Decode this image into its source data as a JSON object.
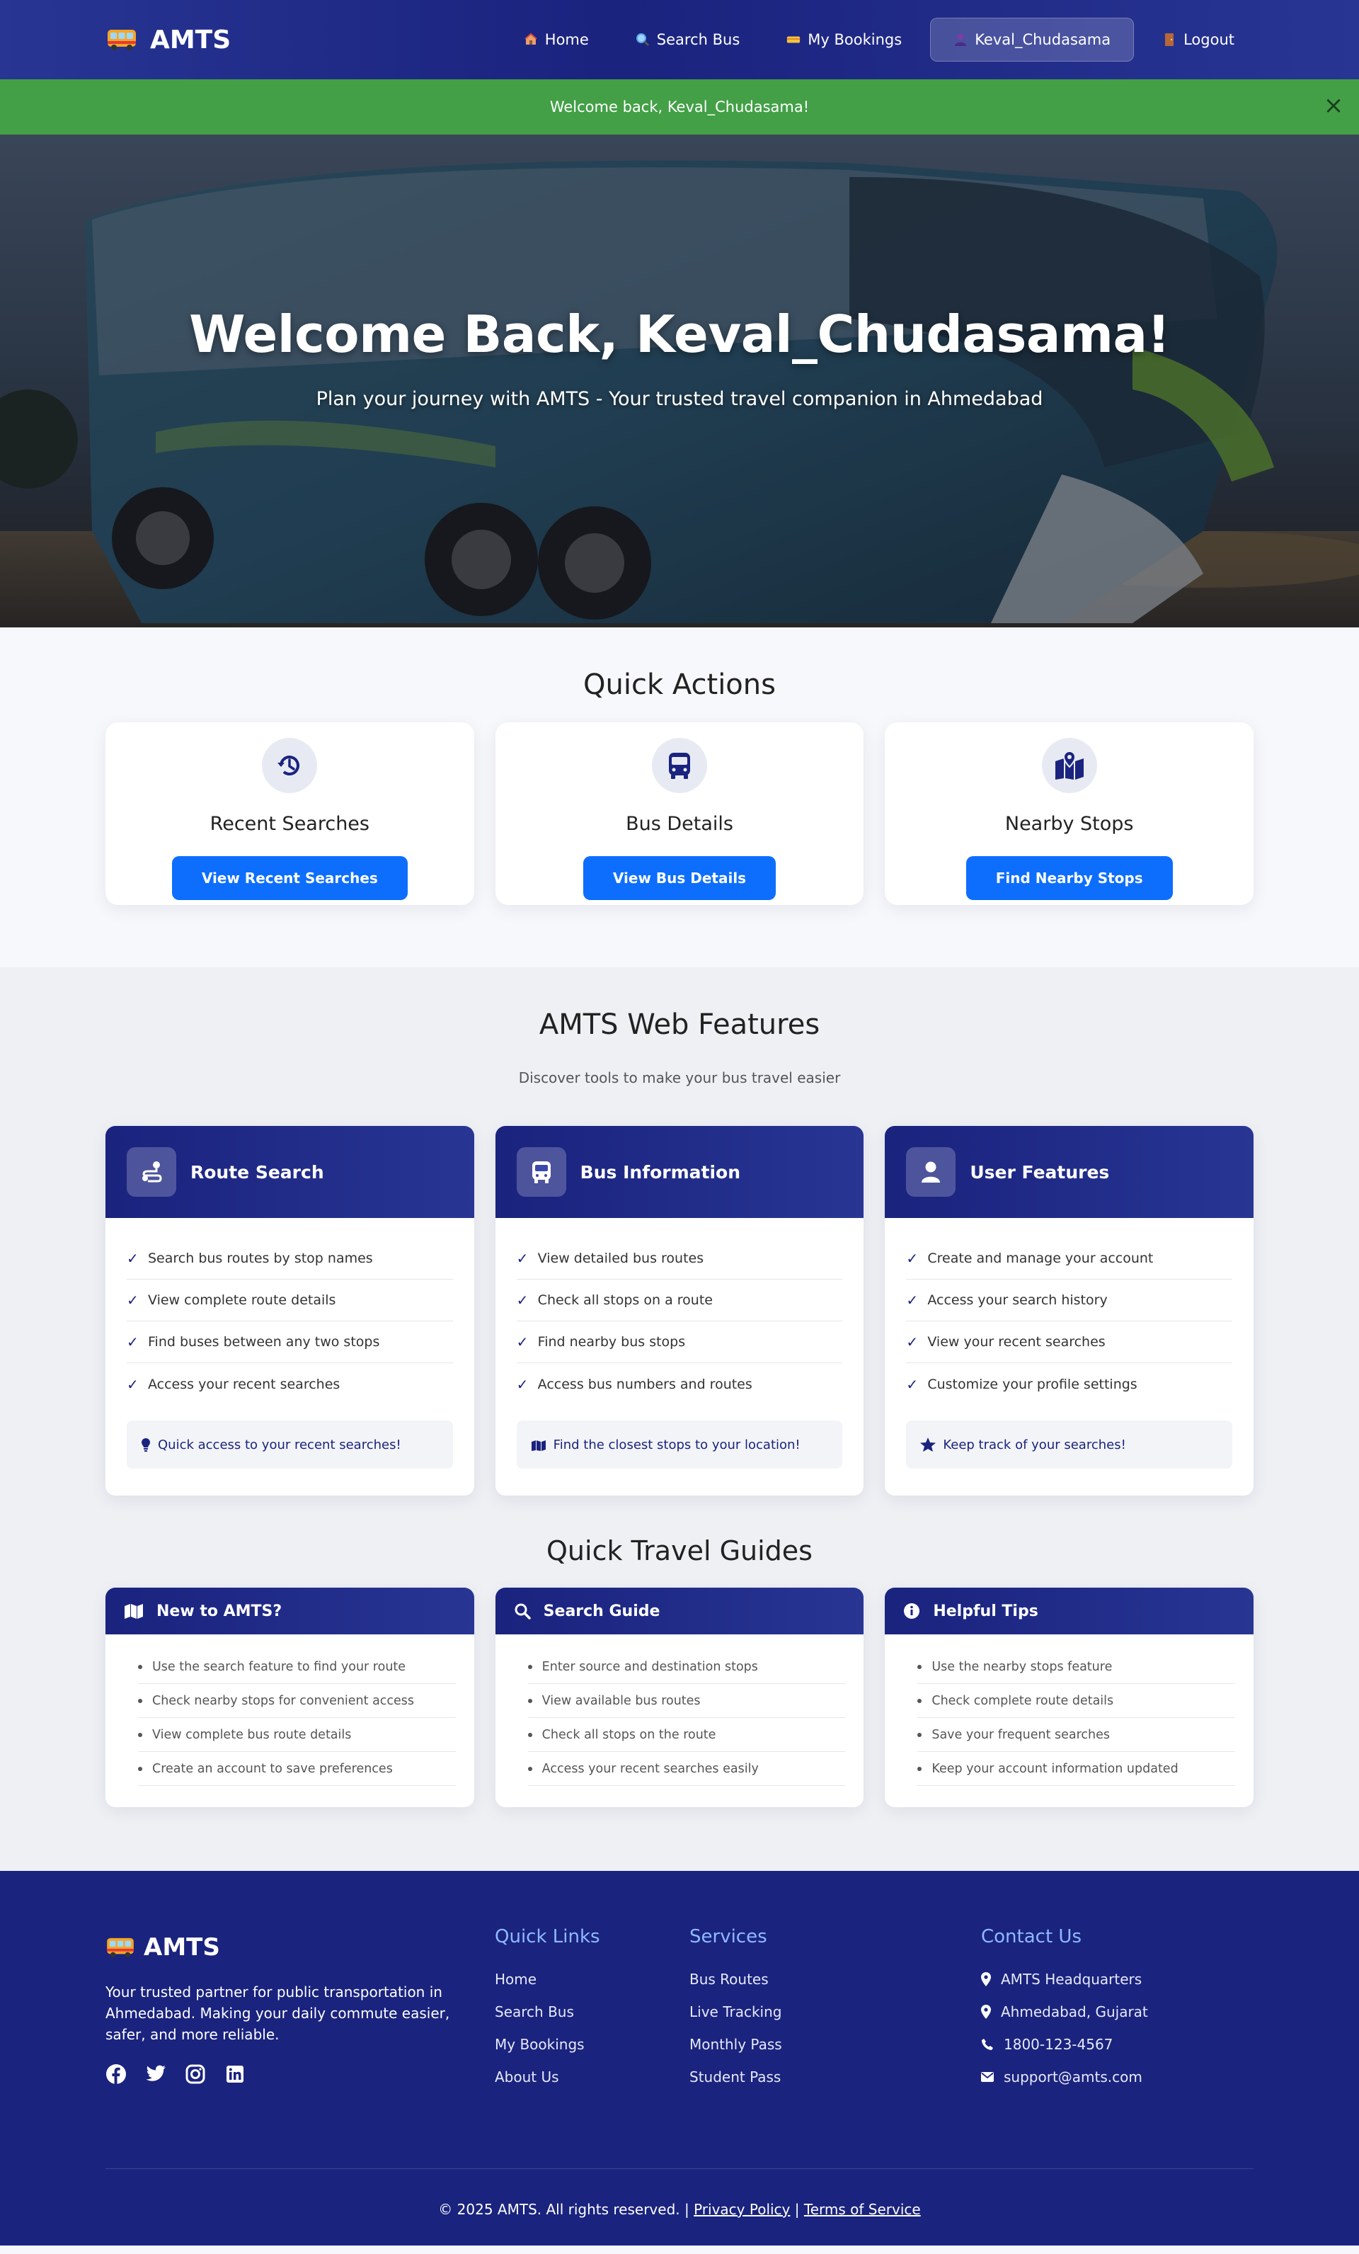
{
  "nav": {
    "brand": "AMTS",
    "links": [
      {
        "label": "Home",
        "icon": "home-icon"
      },
      {
        "label": "Search Bus",
        "icon": "search-icon"
      },
      {
        "label": "My Bookings",
        "icon": "ticket-icon"
      },
      {
        "label": "Keval_Chudasama",
        "icon": "user-icon"
      },
      {
        "label": "Logout",
        "icon": "door-icon"
      }
    ]
  },
  "alert": {
    "message": "Welcome back, Keval_Chudasama!",
    "close": "×"
  },
  "hero": {
    "title": "Welcome Back, Keval_Chudasama!",
    "subtitle": "Plan your journey with AMTS - Your trusted travel companion in Ahmedabad"
  },
  "quick_actions": {
    "title": "Quick Actions",
    "cards": [
      {
        "title": "Recent Searches",
        "button": "View Recent Searches",
        "icon": "history-icon"
      },
      {
        "title": "Bus Details",
        "button": "View Bus Details",
        "icon": "bus-icon"
      },
      {
        "title": "Nearby Stops",
        "button": "Find Nearby Stops",
        "icon": "map-pin-icon"
      }
    ]
  },
  "features": {
    "title": "AMTS Web Features",
    "subtitle": "Discover tools to make your bus travel easier",
    "cards": [
      {
        "title": "Route Search",
        "icon": "route-icon",
        "items": [
          "Search bus routes by stop names",
          "View complete route details",
          "Find buses between any two stops",
          "Access your recent searches"
        ],
        "note": "Quick access to your recent searches!",
        "note_icon": "lightbulb-icon"
      },
      {
        "title": "Bus Information",
        "icon": "bus-icon",
        "items": [
          "View detailed bus routes",
          "Check all stops on a route",
          "Find nearby bus stops",
          "Access bus numbers and routes"
        ],
        "note": "Find the closest stops to your location!",
        "note_icon": "map-icon"
      },
      {
        "title": "User Features",
        "icon": "user-icon",
        "items": [
          "Create and manage your account",
          "Access your search history",
          "View your recent searches",
          "Customize your profile settings"
        ],
        "note": "Keep track of your searches!",
        "note_icon": "star-icon"
      }
    ]
  },
  "guides": {
    "title": "Quick Travel Guides",
    "cards": [
      {
        "title": "New to AMTS?",
        "icon": "map-icon",
        "items": [
          "Use the search feature to find your route",
          "Check nearby stops for convenient access",
          "View complete bus route details",
          "Create an account to save preferences"
        ]
      },
      {
        "title": "Search Guide",
        "icon": "search-icon",
        "items": [
          "Enter source and destination stops",
          "View available bus routes",
          "Check all stops on the route",
          "Access your recent searches easily"
        ]
      },
      {
        "title": "Helpful Tips",
        "icon": "info-icon",
        "items": [
          "Use the nearby stops feature",
          "Check complete route details",
          "Save your frequent searches",
          "Keep your account information updated"
        ]
      }
    ]
  },
  "footer": {
    "brand": "AMTS",
    "description": "Your trusted partner for public transportation in Ahmedabad. Making your daily commute easier, safer, and more reliable.",
    "quick_links": {
      "title": "Quick Links",
      "items": [
        "Home",
        "Search Bus",
        "My Bookings",
        "About Us"
      ]
    },
    "services": {
      "title": "Services",
      "items": [
        "Bus Routes",
        "Live Tracking",
        "Monthly Pass",
        "Student Pass"
      ]
    },
    "contact": {
      "title": "Contact Us",
      "items": [
        {
          "text": "AMTS Headquarters",
          "icon": "location-icon"
        },
        {
          "text": "Ahmedabad, Gujarat",
          "icon": "location-icon"
        },
        {
          "text": "1800-123-4567",
          "icon": "phone-icon"
        },
        {
          "text": "support@amts.com",
          "icon": "email-icon"
        }
      ]
    },
    "copyright": "© 2025 AMTS. All rights reserved. |",
    "privacy": "Privacy Policy",
    "separator": "|",
    "terms": "Terms of Service"
  },
  "colors": {
    "primary": "#1a237e",
    "button": "#0d6efd",
    "alert": "#43a047",
    "footer_heading": "#8fb8ff"
  }
}
